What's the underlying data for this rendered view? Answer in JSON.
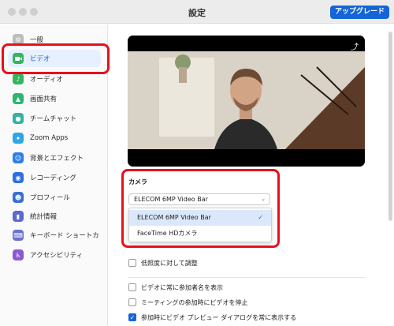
{
  "window": {
    "title": "設定",
    "upgrade_label": "アップグレード"
  },
  "sidebar": {
    "items": [
      {
        "label": "一般",
        "icon": "gear-icon",
        "color": "#9e9e9e"
      },
      {
        "label": "ビデオ",
        "icon": "video-camera-icon",
        "color": "#34b55e"
      },
      {
        "label": "オーディオ",
        "icon": "headphones-icon",
        "color": "#34b55e"
      },
      {
        "label": "画面共有",
        "icon": "share-screen-icon",
        "color": "#2bb673"
      },
      {
        "label": "チームチャット",
        "icon": "chat-bubble-icon",
        "color": "#31b4a1"
      },
      {
        "label": "Zoom Apps",
        "icon": "apps-icon",
        "color": "#2aa7e8"
      },
      {
        "label": "背景とエフェクト",
        "icon": "background-person-icon",
        "color": "#2f7ee8"
      },
      {
        "label": "レコーディング",
        "icon": "record-icon",
        "color": "#2f6ee0"
      },
      {
        "label": "プロフィール",
        "icon": "profile-person-icon",
        "color": "#3a6fd6"
      },
      {
        "label": "統計情報",
        "icon": "statistics-icon",
        "color": "#5a6ad1"
      },
      {
        "label": "キーボード ショートカ",
        "icon": "keyboard-icon",
        "color": "#6b6fd0"
      },
      {
        "label": "アクセシビリティ",
        "icon": "accessibility-icon",
        "color": "#8a5bd0"
      }
    ]
  },
  "camera": {
    "label": "カメラ",
    "selected": "ELECOM 6MP Video Bar",
    "options": [
      "ELECOM 6MP Video Bar",
      "FaceTime HDカメラ"
    ]
  },
  "options": {
    "low_light": "低照度に対して調整",
    "show_names": "ビデオに常に参加者名を表示",
    "stop_video": "ミーティングの参加時にビデオを停止",
    "preview_dialog": "参加時にビデオ プレビュー ダイアログを常に表示する"
  },
  "colors": {
    "accent": "#1565d8",
    "highlight_ring": "#e8101b"
  }
}
